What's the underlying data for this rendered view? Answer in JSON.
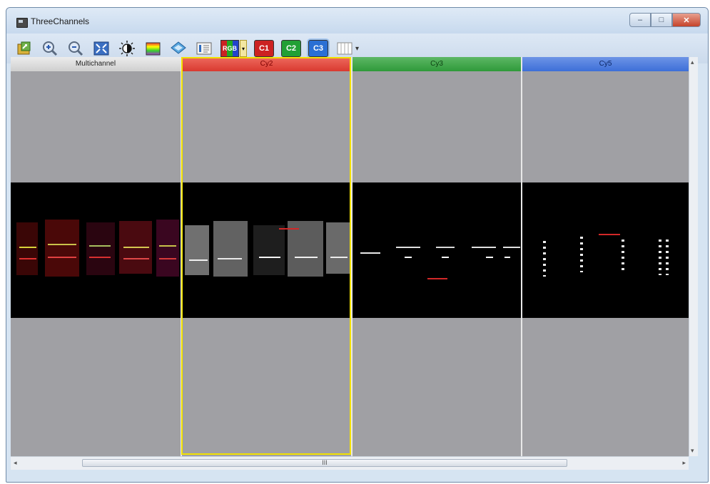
{
  "window": {
    "title": "ThreeChannels"
  },
  "caption_buttons": {
    "minimize": "–",
    "maximize": "□",
    "close": "✕"
  },
  "toolbar": {
    "icons": [
      "export-icon",
      "zoom-in-icon",
      "zoom-out-icon",
      "fit-icon",
      "contrast-icon",
      "colormap-icon",
      "layers-icon",
      "info-icon",
      "rgb-icon"
    ],
    "rgb_label": "RGB",
    "c1_label": "C1",
    "c2_label": "C2",
    "c3_label": "C3",
    "dropdown_arrow": "▾"
  },
  "channels": [
    {
      "label": "Multichannel",
      "header_color": "#d7d7d7",
      "text_color": "#222222"
    },
    {
      "label": "Cy2",
      "header_color": "#e0413a",
      "text_color": "#7a0000"
    },
    {
      "label": "Cy3",
      "header_color": "#2f9a3a",
      "text_color": "#0d3f12"
    },
    {
      "label": "Cy5",
      "header_color": "#3d6fd8",
      "text_color": "#0b2463"
    }
  ],
  "scroll": {
    "h_thumb_grip": "III",
    "left_arrow": "◂",
    "right_arrow": "▸",
    "up_arrow": "▴",
    "down_arrow": "▾"
  },
  "colors": {
    "selection": "#f2e100",
    "panel_bg": "#a0a0a4",
    "image_bg": "#000000"
  }
}
